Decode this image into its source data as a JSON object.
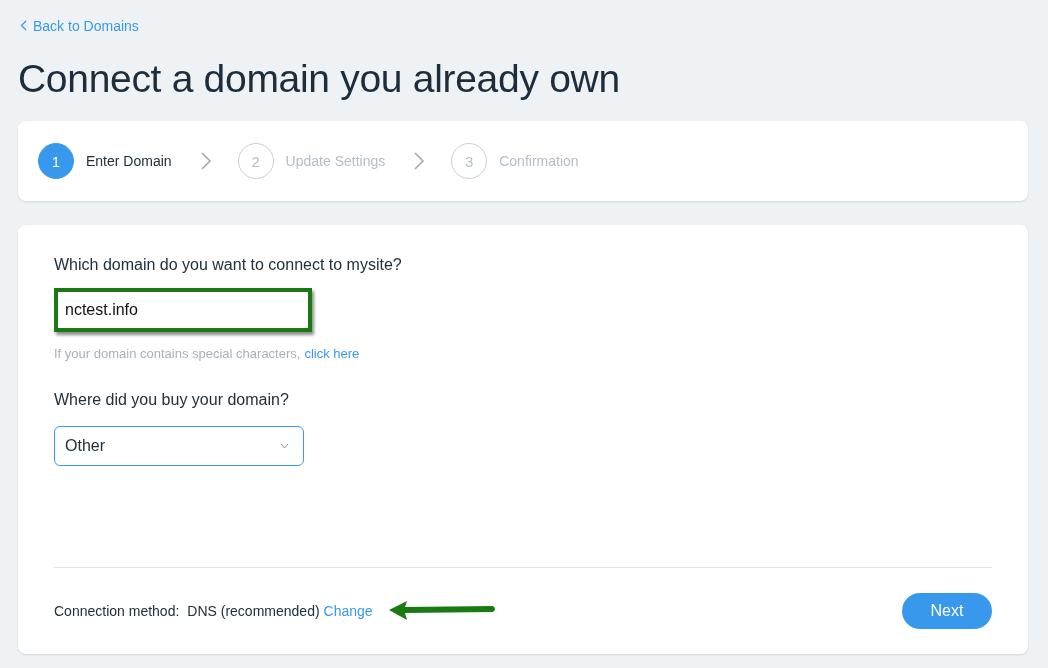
{
  "back_link": "Back to Domains",
  "title": "Connect a domain you already own",
  "steps": [
    {
      "number": "1",
      "label": "Enter Domain",
      "selected": true
    },
    {
      "number": "2",
      "label": "Update Settings",
      "selected": false
    },
    {
      "number": "3",
      "label": "Confirmation",
      "selected": false
    }
  ],
  "domain_question": "Which domain do you want to connect to mysite?",
  "domain_field": {
    "value": "nctest.info",
    "highlighted": true
  },
  "hint": {
    "text": "If your domain contains special characters,",
    "link": "click here"
  },
  "registrar_question": "Where did you buy your domain?",
  "registrar_select": {
    "value": "Other"
  },
  "footer": {
    "label": "Connection method:",
    "value": "DNS (recommended)",
    "link": "Change",
    "annotation_arrow": true
  },
  "next_button": "Next"
}
